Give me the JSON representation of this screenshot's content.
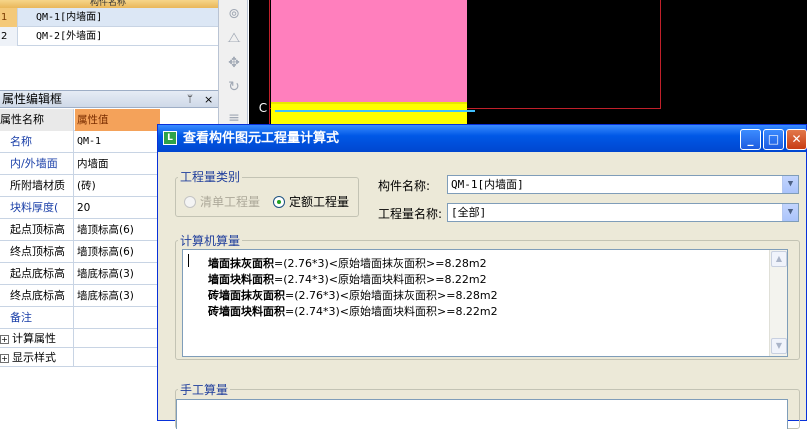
{
  "component_list": {
    "header_label": "构件名称",
    "rows": [
      {
        "index": "1",
        "name": "QM-1[内墙面]"
      },
      {
        "index": "2",
        "name": "QM-2[外墙面]"
      }
    ]
  },
  "property_panel": {
    "title": "属性编辑框",
    "pin": "ᛘ",
    "close": "×",
    "col_name": "属性名称",
    "col_value": "属性值",
    "rows": [
      {
        "key": "名称",
        "value": "QM-1"
      },
      {
        "key": "内/外墙面",
        "value": "内墙面"
      },
      {
        "key": "所附墙材质",
        "value": "(砖)"
      },
      {
        "key": "块料厚度(",
        "value": "20"
      },
      {
        "key": "起点顶标高",
        "value": "墙顶标高(6)"
      },
      {
        "key": "终点顶标高",
        "value": "墙顶标高(6)"
      },
      {
        "key": "起点底标高",
        "value": "墙底标高(3)"
      },
      {
        "key": "终点底标高",
        "value": "墙底标高(3)"
      },
      {
        "key": "备注",
        "value": ""
      }
    ],
    "groups": [
      {
        "toggle": "+",
        "label": "计算属性"
      },
      {
        "toggle": "+",
        "label": "显示样式"
      }
    ]
  },
  "toolstrip": {
    "icons": [
      "orbit-icon",
      "mirror-icon",
      "move-icon",
      "rotate-icon",
      "grip-icon"
    ]
  },
  "canvas": {
    "marker_label": "C",
    "colors": {
      "background": "#000000",
      "wall": "#ff7fbd",
      "tile": "#ffff00",
      "line": "#c0202a"
    }
  },
  "dialog": {
    "title": "查看构件图元工程量计算式",
    "app_icon": "L",
    "buttons": {
      "minimize": "_",
      "maximize": "□",
      "close": "✕"
    },
    "quantity_type": {
      "legend": "工程量类别",
      "options": [
        {
          "label": "清单工程量",
          "selected": false,
          "enabled": false
        },
        {
          "label": "定额工程量",
          "selected": true,
          "enabled": true
        }
      ]
    },
    "component_name_label": "构件名称:",
    "component_name_value": "QM-1[内墙面]",
    "quantity_name_label": "工程量名称:",
    "quantity_name_value": "[全部]",
    "computer_calc": {
      "legend": "计算机算量",
      "lines": [
        {
          "name": "墙面抹灰面积",
          "formula": "=(2.76*3)<原始墙面抹灰面积>=8.28m2"
        },
        {
          "name": "墙面块料面积",
          "formula": "=(2.74*3)<原始墙面块料面积>=8.22m2"
        },
        {
          "name": "砖墙面抹灰面积",
          "formula": "=(2.76*3)<原始墙面抹灰面积>=8.28m2"
        },
        {
          "name": "砖墙面块料面积",
          "formula": "=(2.74*3)<原始墙面块料面积>=8.22m2"
        }
      ]
    },
    "manual_calc": {
      "legend": "手工算量"
    }
  }
}
